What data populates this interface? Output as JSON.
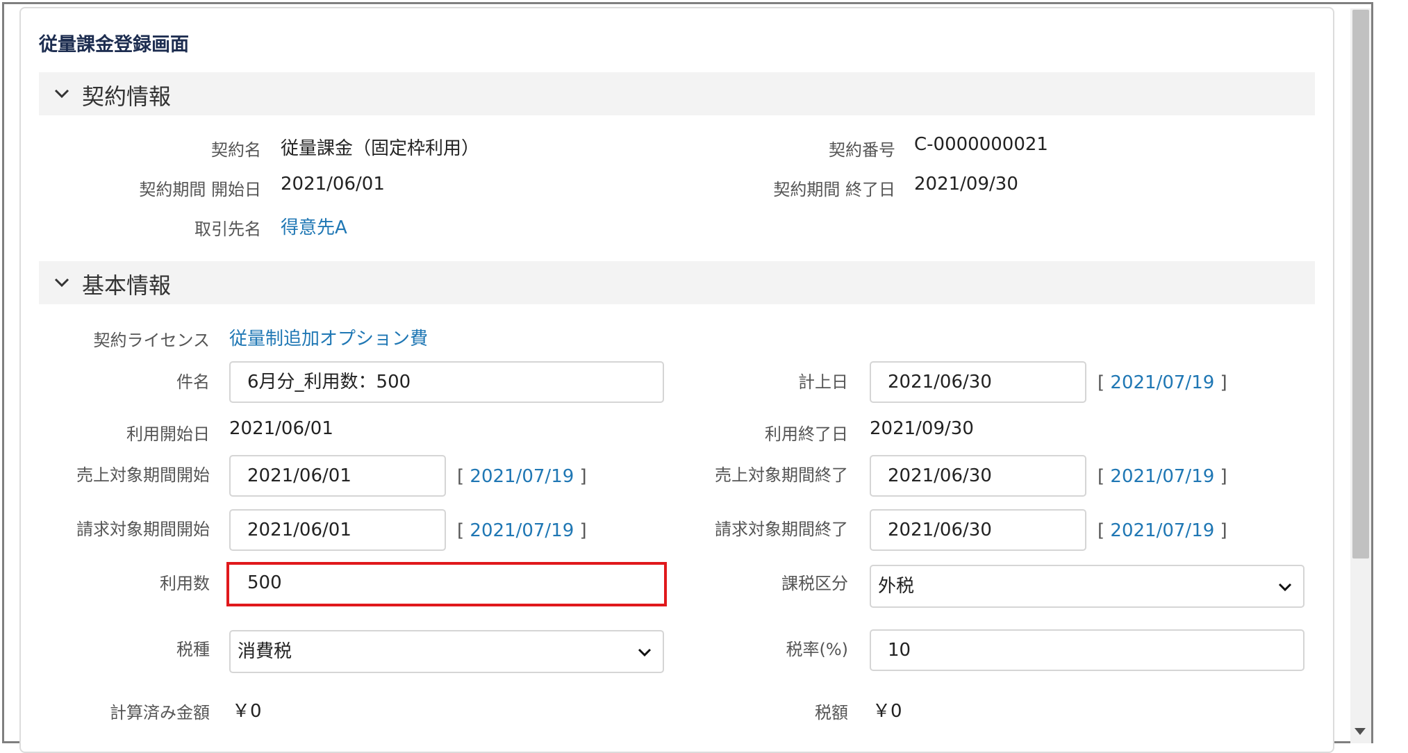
{
  "page": {
    "title": "従量課金登録画面"
  },
  "sections": {
    "contract": {
      "title": "契約情報"
    },
    "basic": {
      "title": "基本情報"
    }
  },
  "contract": {
    "name_label": "契約名",
    "name_value": "従量課金（固定枠利用）",
    "number_label": "契約番号",
    "number_value": "C-0000000021",
    "start_label": "契約期間 開始日",
    "start_value": "2021/06/01",
    "end_label": "契約期間 終了日",
    "end_value": "2021/09/30",
    "client_label": "取引先名",
    "client_value": "得意先A"
  },
  "basic": {
    "license_label": "契約ライセンス",
    "license_value": "従量制追加オプション費",
    "subject_label": "件名",
    "subject_value": "6月分_利用数：500",
    "posting_label": "計上日",
    "posting_value": "2021/06/30",
    "posting_link": "2021/07/19",
    "use_start_label": "利用開始日",
    "use_start_value": "2021/06/01",
    "use_end_label": "利用終了日",
    "use_end_value": "2021/09/30",
    "sales_start_label": "売上対象期間開始",
    "sales_start_value": "2021/06/01",
    "sales_start_link": "2021/07/19",
    "sales_end_label": "売上対象期間終了",
    "sales_end_value": "2021/06/30",
    "sales_end_link": "2021/07/19",
    "bill_start_label": "請求対象期間開始",
    "bill_start_value": "2021/06/01",
    "bill_start_link": "2021/07/19",
    "bill_end_label": "請求対象期間終了",
    "bill_end_value": "2021/06/30",
    "bill_end_link": "2021/07/19",
    "usage_label": "利用数",
    "usage_value": "500",
    "tax_class_label": "課税区分",
    "tax_class_value": "外税",
    "tax_type_label": "税種",
    "tax_type_value": "消費税",
    "tax_rate_label": "税率(%)",
    "tax_rate_value": "10",
    "calc_amount_label": "計算済み金額",
    "calc_amount_value": "￥0",
    "tax_amount_label": "税額",
    "tax_amount_value": "￥0"
  },
  "brackets": {
    "open": "[",
    "close": "]"
  },
  "colors": {
    "link": "#1f77b4",
    "highlight": "#e0191c",
    "section_bg": "#f3f3f3"
  },
  "icons": {
    "section_toggle": "chevron-down-icon",
    "select_caret": "chevron-down-icon"
  }
}
